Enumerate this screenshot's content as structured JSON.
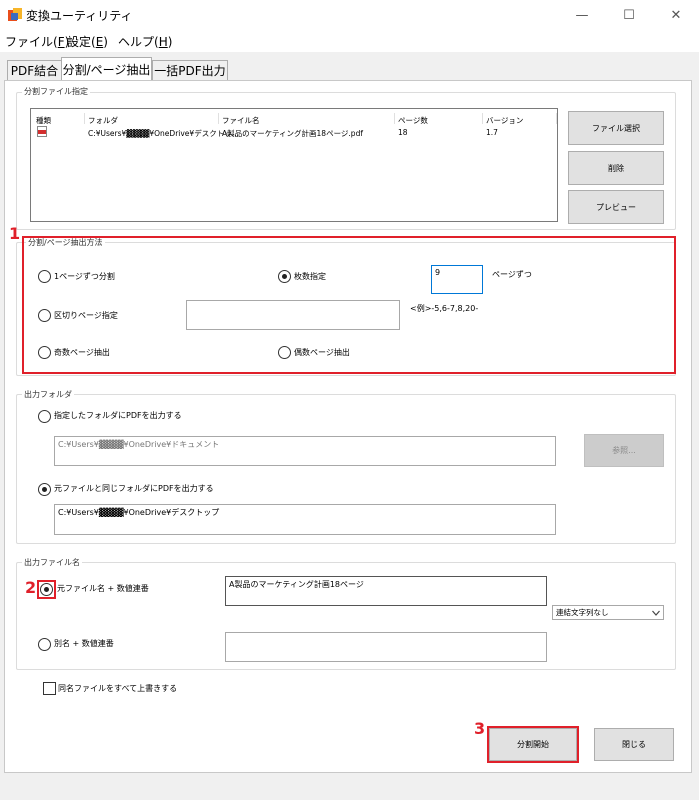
{
  "window": {
    "title": "変換ユーティリティ"
  },
  "menu": {
    "items": [
      {
        "text": "ファイル(",
        "key": "F",
        "end": ")"
      },
      {
        "text": "設定(",
        "key": "E",
        "end": ")"
      },
      {
        "text": "ヘルプ(",
        "key": "H",
        "end": ")"
      }
    ]
  },
  "tabs": [
    {
      "label": "PDF結合"
    },
    {
      "label": "分割/ページ抽出"
    },
    {
      "label": "一括PDF出力"
    }
  ],
  "file_group": {
    "label": "分割ファイル指定",
    "columns": [
      "種類",
      "フォルダ",
      "ファイル名",
      "ページ数",
      "バージョン"
    ],
    "row": {
      "folder": "C:¥Users¥▓▓▓▓¥OneDrive¥デスクトッ...",
      "file": "A製品のマーケティング計画18ページ.pdf",
      "pages": "18",
      "version": "1.7"
    },
    "buttons": {
      "select": "ファイル選択",
      "delete": "削除",
      "preview": "プレビュー"
    }
  },
  "method_group": {
    "label": "分割/ページ抽出方法",
    "options": {
      "each_page": "1ページずつ分割",
      "count": "枚数指定",
      "range": "区切りページ指定",
      "odd": "奇数ページ抽出",
      "even": "偶数ページ抽出"
    },
    "count_value": "9",
    "count_suffix": "ページずつ",
    "range_hint": "<例>-5,6-7,8,20-"
  },
  "output_folder": {
    "label": "出力フォルダ",
    "opt_specified": "指定したフォルダにPDFを出力する",
    "specified_path": "C:¥Users¥▓▓▓▓¥OneDrive¥ドキュメント",
    "browse": "参照...",
    "opt_same": "元ファイルと同じフォルダにPDFを出力する",
    "same_path": "C:¥Users¥▓▓▓▓¥OneDrive¥デスクトップ"
  },
  "output_name": {
    "label": "出力ファイル名",
    "opt_original": "元ファイル名 + 数値連番",
    "original_value": "A製品のマーケティング計画18ページ",
    "separator_select": "連結文字列なし",
    "opt_alias": "別名 + 数値連番"
  },
  "overwrite": "同名ファイルをすべて上書きする",
  "actions": {
    "start": "分割開始",
    "close": "閉じる"
  },
  "annotations": {
    "one": "1",
    "two": "2",
    "three": "3"
  },
  "colors": {
    "annotation": "#e0202a"
  }
}
